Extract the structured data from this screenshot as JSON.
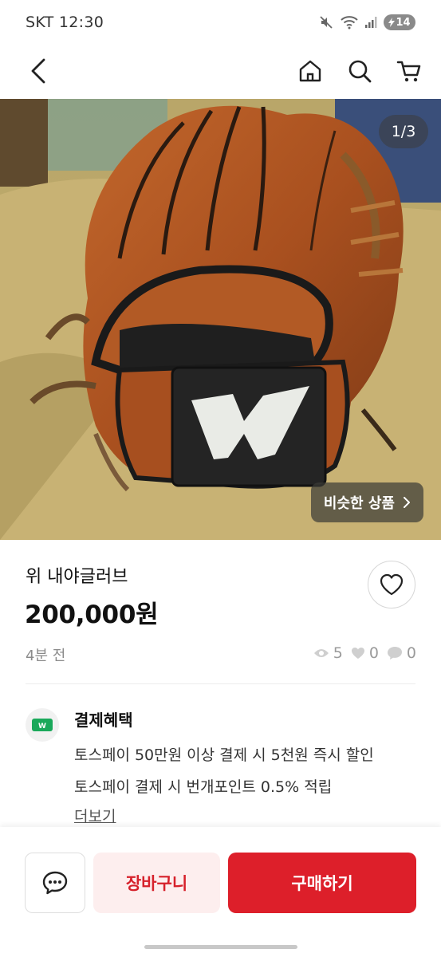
{
  "status_bar": {
    "carrier_time": "SKT 12:30",
    "battery": "14"
  },
  "nav": {
    "icons": [
      "back-icon",
      "home-icon",
      "search-icon",
      "cart-icon"
    ]
  },
  "hero": {
    "page_indicator": "1/3",
    "similar_button": "비슷한 상품",
    "image_logo": "W"
  },
  "product": {
    "title": "위 내야글러브",
    "price": "200,000원",
    "time_ago": "4분 전",
    "views": "5",
    "likes": "0",
    "chats": "0"
  },
  "benefit": {
    "icon_label": "W",
    "title": "결제혜택",
    "line1": "토스페이 50만원 이상 결제 시 5천원 즉시 할인",
    "line2": "토스페이 결제 시 번개포인트 0.5% 적립",
    "more": "더보기"
  },
  "bottom_bar": {
    "cart_label": "장바구니",
    "buy_label": "구매하기"
  },
  "colors": {
    "accent_red": "#dd1f2a",
    "cart_bg": "#fdeeee",
    "benefit_green": "#1aa85a"
  }
}
